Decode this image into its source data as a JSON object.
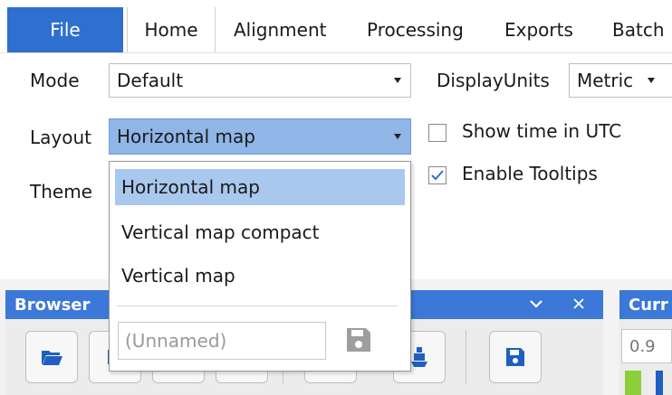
{
  "ribbon": {
    "file_label": "File",
    "tabs": [
      "Home",
      "Alignment",
      "Processing",
      "Exports",
      "Batch"
    ]
  },
  "options": {
    "mode_label": "Mode",
    "mode_value": "Default",
    "display_units_label": "DisplayUnits",
    "display_units_value": "Metric",
    "layout_label": "Layout",
    "layout_value": "Horizontal map",
    "theme_label": "Theme",
    "show_utc_label": "Show time in UTC",
    "show_utc_checked": false,
    "tooltips_label": "Enable Tooltips",
    "tooltips_checked": true
  },
  "layout_dropdown": {
    "options": [
      "Horizontal map",
      "Vertical map compact",
      "Vertical map"
    ],
    "selected_index": 0,
    "name_placeholder": "(Unnamed)",
    "save_icon": "save-disabled-icon"
  },
  "browser_panel": {
    "title": "Browser",
    "tool_icons": [
      "folder-open-icon",
      "toolbar-icon",
      "toolbar-icon",
      "toolbar-icon",
      "toolbar-icon",
      "vessel-icon",
      "save-icon"
    ]
  },
  "curr_panel": {
    "title": "Curr",
    "value": "0.9"
  },
  "colors": {
    "accent": "#2f6fd0",
    "panel_header": "#3b78d8",
    "selection": "#a9c8ee",
    "combo_active": "#8fb6e6",
    "save_icon": "#1f5fbf",
    "swatch_green": "#8ccf3a"
  }
}
